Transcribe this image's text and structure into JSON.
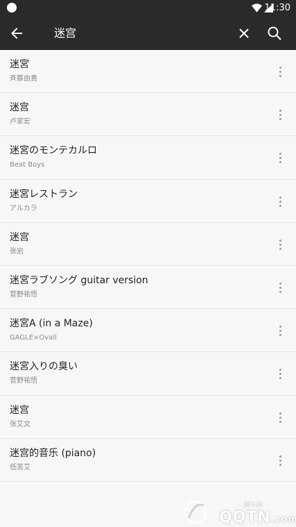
{
  "status_bar": {
    "time": "11:30"
  },
  "search": {
    "query": "迷宫"
  },
  "results": [
    {
      "title": "迷宮",
      "artist": "斉藤由貴"
    },
    {
      "title": "迷宫",
      "artist": "卢家宏"
    },
    {
      "title": "迷宮のモンテカルロ",
      "artist": "Beat Boys"
    },
    {
      "title": "迷宮レストラン",
      "artist": "アルカラ"
    },
    {
      "title": "迷宫",
      "artist": "张岩"
    },
    {
      "title": "迷宮ラブソング guitar version",
      "artist": "菅野祐悟"
    },
    {
      "title": "迷宮A (in a Maze)",
      "artist": "GAGLE×Ovall"
    },
    {
      "title": "迷宮入りの臭い",
      "artist": "菅野祐悟"
    },
    {
      "title": "迷宫",
      "artist": "张艾文"
    },
    {
      "title": "迷宫的音乐 (piano)",
      "artist": "低苦艾"
    }
  ],
  "watermark": {
    "brand": "QQTN",
    "suffix": ".com",
    "small": "腾牛网"
  },
  "colors": {
    "app_bar": "#2b2b2b",
    "background": "#f7f7f7",
    "divider": "#e4e4e4"
  }
}
